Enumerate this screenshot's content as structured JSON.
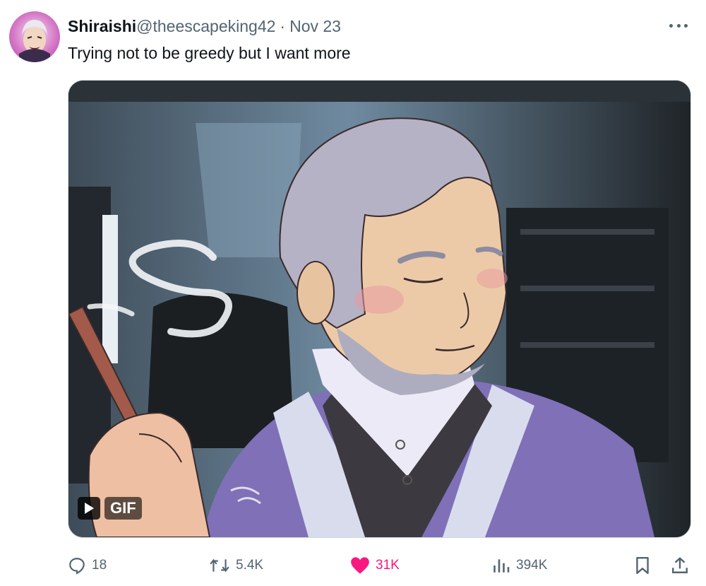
{
  "tweet": {
    "display_name": "Shiraishi",
    "handle": "@theescapeking42",
    "separator": "·",
    "date": "Nov 23",
    "text": "Trying not to be greedy but I want more"
  },
  "media": {
    "type": "gif",
    "badge_label": "GIF"
  },
  "actions": {
    "replies": "18",
    "reposts": "5.4K",
    "likes": "31K",
    "views": "394K"
  },
  "colors": {
    "like_active": "#f91880",
    "secondary_text": "#536471",
    "primary_text": "#0f1419"
  },
  "icons": [
    "more-options-icon",
    "play-icon",
    "reply-icon",
    "repost-icon",
    "heart-icon",
    "views-icon",
    "bookmark-icon",
    "share-icon"
  ]
}
